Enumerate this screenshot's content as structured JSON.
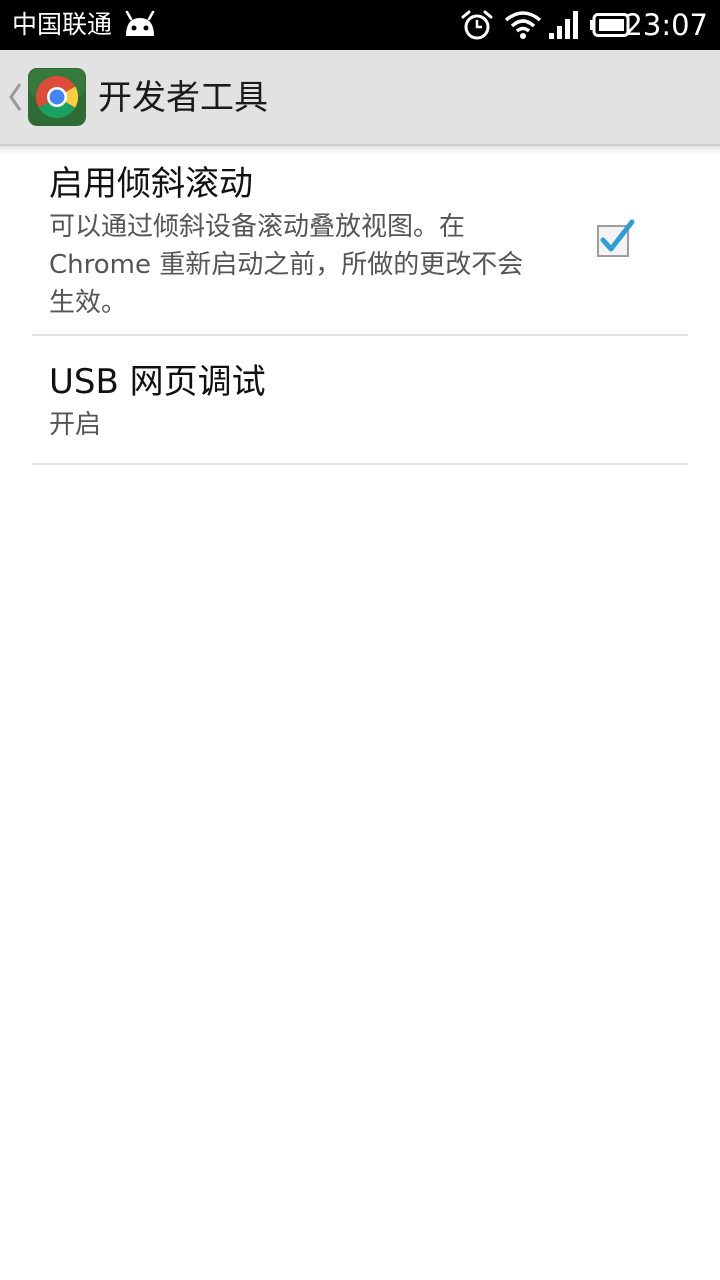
{
  "status_bar": {
    "carrier": "中国联通",
    "time": "23:07",
    "icons": [
      "android-icon",
      "alarm-icon",
      "wifi-icon",
      "signal-icon",
      "battery-icon"
    ]
  },
  "action_bar": {
    "title": "开发者工具",
    "up_icon": "chevron-left-icon",
    "app_icon": "chrome-icon"
  },
  "preferences": [
    {
      "title": "启用倾斜滚动",
      "summary": "可以通过倾斜设备滚动叠放视图。在 Chrome 重新启动之前，所做的更改不会生效。",
      "checked": true
    },
    {
      "title": "USB 网页调试",
      "summary": "开启"
    }
  ],
  "colors": {
    "status_bar_bg": "#000000",
    "action_bar_bg": "#e2e2e2",
    "checkbox_accent": "#2f9ed8",
    "divider": "#e3e3e3"
  }
}
